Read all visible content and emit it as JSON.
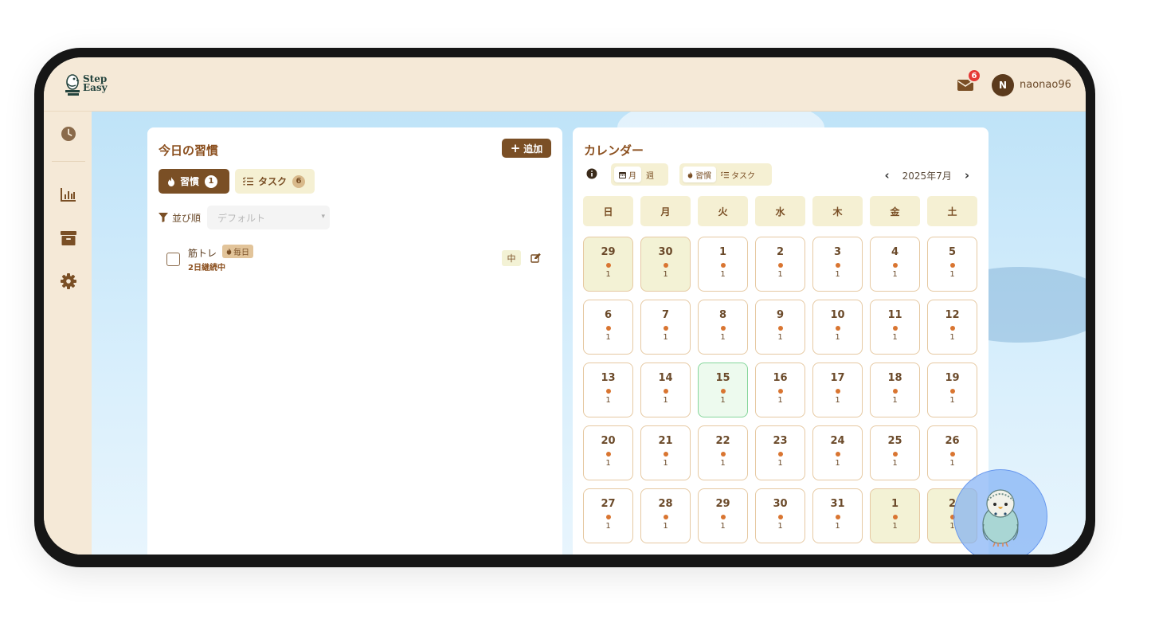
{
  "app": {
    "logo_text_line1": "Step",
    "logo_text_line2": "Easy",
    "mail_count": "6",
    "user_initial": "N",
    "username": "naonao96"
  },
  "sidebar": {
    "items": [
      {
        "icon": "clock-icon"
      },
      {
        "icon": "chart-icon"
      },
      {
        "icon": "archive-icon"
      },
      {
        "icon": "gear-icon"
      }
    ]
  },
  "habits_panel": {
    "title": "今日の習慣",
    "add_label": "追加",
    "tabs": [
      {
        "label": "習慣",
        "count": "1"
      },
      {
        "label": "タスク",
        "count": "6"
      }
    ],
    "sort_label": "並び順",
    "sort_value": "デフォルト",
    "habits": [
      {
        "name": "筋トレ",
        "frequency": "毎日",
        "streak": "2日継続中",
        "level": "中"
      }
    ]
  },
  "calendar_panel": {
    "title": "カレンダー",
    "view_month": "月",
    "view_week": "週",
    "type_habit": "習慣",
    "type_task": "タスク",
    "month_label": "2025年7月",
    "weekdays": [
      "日",
      "月",
      "火",
      "水",
      "木",
      "金",
      "土"
    ],
    "weeks": [
      [
        {
          "d": "29",
          "c": "1",
          "o": true
        },
        {
          "d": "30",
          "c": "1",
          "o": true
        },
        {
          "d": "1",
          "c": "1"
        },
        {
          "d": "2",
          "c": "1"
        },
        {
          "d": "3",
          "c": "1"
        },
        {
          "d": "4",
          "c": "1"
        },
        {
          "d": "5",
          "c": "1"
        }
      ],
      [
        {
          "d": "6",
          "c": "1"
        },
        {
          "d": "7",
          "c": "1"
        },
        {
          "d": "8",
          "c": "1"
        },
        {
          "d": "9",
          "c": "1"
        },
        {
          "d": "10",
          "c": "1"
        },
        {
          "d": "11",
          "c": "1"
        },
        {
          "d": "12",
          "c": "1"
        }
      ],
      [
        {
          "d": "13",
          "c": "1"
        },
        {
          "d": "14",
          "c": "1"
        },
        {
          "d": "15",
          "c": "1",
          "t": true
        },
        {
          "d": "16",
          "c": "1"
        },
        {
          "d": "17",
          "c": "1"
        },
        {
          "d": "18",
          "c": "1"
        },
        {
          "d": "19",
          "c": "1"
        }
      ],
      [
        {
          "d": "20",
          "c": "1"
        },
        {
          "d": "21",
          "c": "1"
        },
        {
          "d": "22",
          "c": "1"
        },
        {
          "d": "23",
          "c": "1"
        },
        {
          "d": "24",
          "c": "1"
        },
        {
          "d": "25",
          "c": "1"
        },
        {
          "d": "26",
          "c": "1"
        }
      ],
      [
        {
          "d": "27",
          "c": "1"
        },
        {
          "d": "28",
          "c": "1"
        },
        {
          "d": "29",
          "c": "1"
        },
        {
          "d": "30",
          "c": "1"
        },
        {
          "d": "31",
          "c": "1"
        },
        {
          "d": "1",
          "c": "1",
          "o": true
        },
        {
          "d": "2",
          "c": "1",
          "o": true
        }
      ]
    ]
  },
  "colors": {
    "brown": "#7a4f25",
    "cream": "#f5e9d7",
    "today_green": "#86d69b",
    "dot_orange": "#d97531"
  }
}
